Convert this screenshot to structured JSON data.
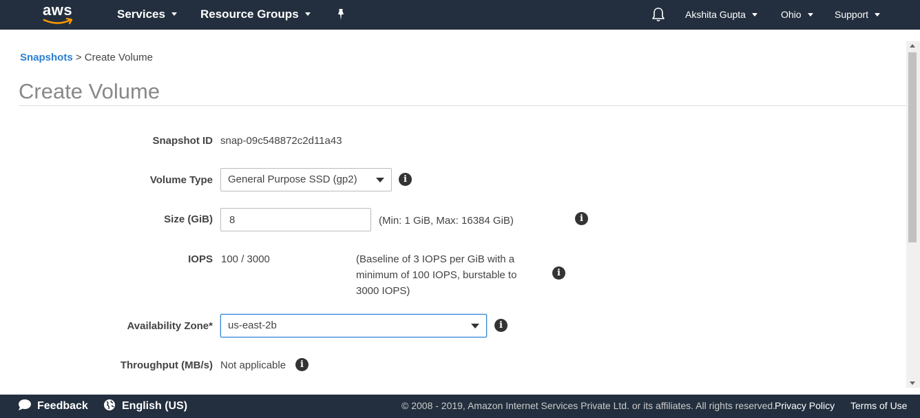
{
  "nav": {
    "logo_text": "aws",
    "services": "Services",
    "resource_groups": "Resource Groups",
    "user": "Akshita Gupta",
    "region": "Ohio",
    "support": "Support"
  },
  "breadcrumb": {
    "parent": "Snapshots",
    "separator": ">",
    "current": "Create Volume"
  },
  "page_title": "Create Volume",
  "form": {
    "snapshot_id": {
      "label": "Snapshot ID",
      "value": "snap-09c548872c2d11a43"
    },
    "volume_type": {
      "label": "Volume Type",
      "value": "General Purpose SSD (gp2)"
    },
    "size": {
      "label": "Size (GiB)",
      "value": "8",
      "hint": "(Min: 1 GiB, Max: 16384 GiB)"
    },
    "iops": {
      "label": "IOPS",
      "value": "100 / 3000",
      "hint_line1": "(Baseline of 3 IOPS per GiB with a",
      "hint_line2": "minimum of 100 IOPS, burstable to",
      "hint_line3": "3000 IOPS)"
    },
    "availability_zone": {
      "label": "Availability Zone*",
      "value": "us-east-2b"
    },
    "throughput": {
      "label": "Throughput (MB/s)",
      "value": "Not applicable"
    }
  },
  "info_glyph": "i",
  "footer": {
    "feedback": "Feedback",
    "language": "English (US)",
    "copyright": "© 2008 - 2019, Amazon Internet Services Private Ltd. or its affiliates. All rights reserved.",
    "privacy": "Privacy Policy",
    "terms": "Terms of Use"
  },
  "colors": {
    "nav_bg": "#232f3e",
    "link": "#2a7fd4",
    "logo_smile": "#ff9900"
  }
}
